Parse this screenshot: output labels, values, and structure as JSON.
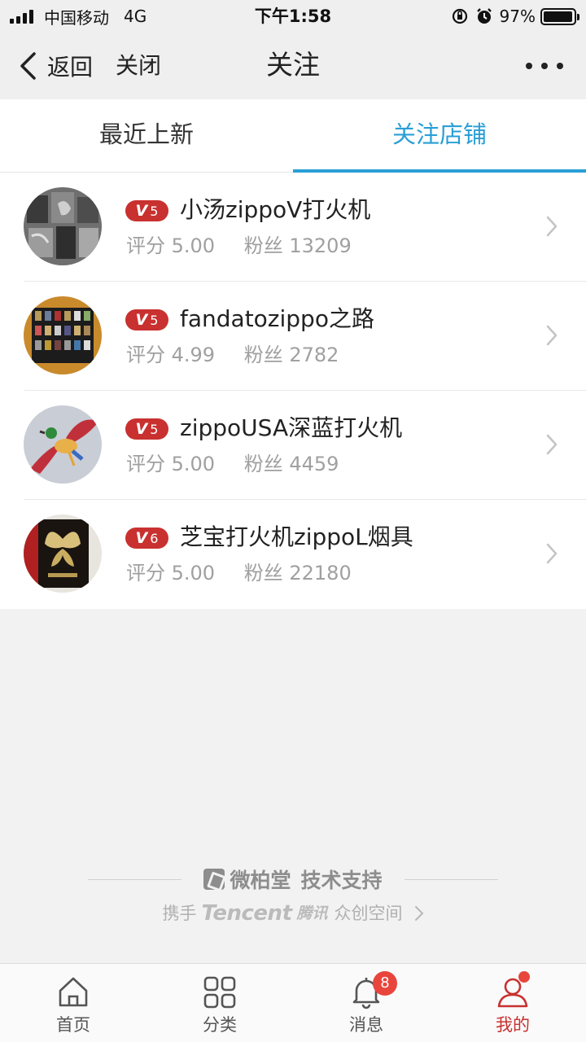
{
  "status_bar": {
    "carrier": "中国移动",
    "network": "4G",
    "time": "下午1:58",
    "battery": "97%",
    "battery_level": 0.97
  },
  "nav": {
    "back_label": "返回",
    "close_label": "关闭",
    "title": "关注"
  },
  "tabs": [
    {
      "label": "最近上新",
      "active": false
    },
    {
      "label": "关注店铺",
      "active": true
    }
  ],
  "shops": [
    {
      "level": "5",
      "name": "小汤zippoV打火机",
      "rating_label": "评分",
      "rating": "5.00",
      "fans_label": "粉丝",
      "fans": "13209"
    },
    {
      "level": "5",
      "name": "fandatozippo之路",
      "rating_label": "评分",
      "rating": "4.99",
      "fans_label": "粉丝",
      "fans": "2782"
    },
    {
      "level": "5",
      "name": "zippoUSA深蓝打火机",
      "rating_label": "评分",
      "rating": "5.00",
      "fans_label": "粉丝",
      "fans": "4459"
    },
    {
      "level": "6",
      "name": "芝宝打火机zippoL烟具",
      "rating_label": "评分",
      "rating": "5.00",
      "fans_label": "粉丝",
      "fans": "22180"
    }
  ],
  "level_prefix": "V",
  "footer": {
    "brand": "微柏堂",
    "support": "技术支持",
    "partner_prefix": "携手",
    "partner_en": "Tencent",
    "partner_cn": "腾讯",
    "partner_suffix": "众创空间"
  },
  "tabbar": [
    {
      "label": "首页",
      "icon": "home-icon"
    },
    {
      "label": "分类",
      "icon": "grid-icon"
    },
    {
      "label": "消息",
      "icon": "bell-icon",
      "badge": "8"
    },
    {
      "label": "我的",
      "icon": "user-icon",
      "active": true
    }
  ],
  "colors": {
    "accent": "#2a9fd6",
    "brand_red": "#c8312f",
    "badge_red": "#e8453c"
  }
}
